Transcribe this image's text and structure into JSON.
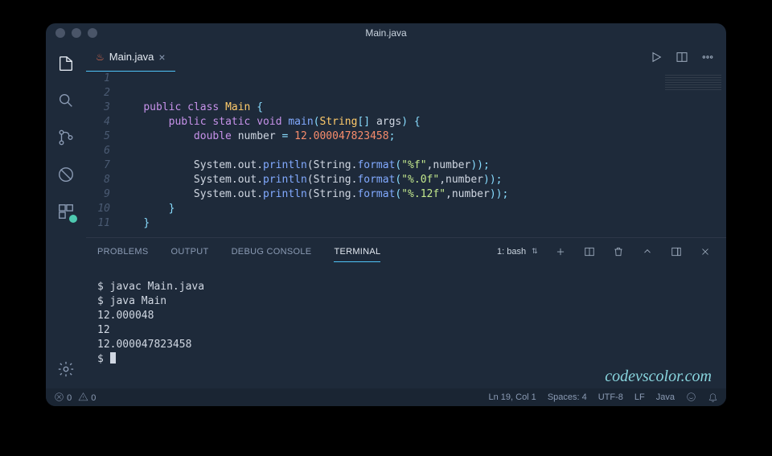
{
  "window_title": "Main.java",
  "tab": {
    "filename": "Main.java"
  },
  "editor": {
    "line_numbers": [
      "1",
      "2",
      "3",
      "4",
      "5",
      "6",
      "7",
      "8",
      "9",
      "10",
      "11"
    ]
  },
  "code": {
    "l2_public": "public",
    "l2_class": "class",
    "l2_Main": "Main",
    "l2_brace": " {",
    "l3_public": "public",
    "l3_static": "static",
    "l3_void": "void",
    "l3_main": "main",
    "l3_paren1": "(",
    "l3_String": "String",
    "l3_brackets": "[] ",
    "l3_args": "args",
    "l3_paren2": ") {",
    "l4_double": "double",
    "l4_number": "number",
    "l4_eq": " = ",
    "l4_val": "12.000047823458",
    "l4_semi": ";",
    "sop_pre": "System.out.",
    "println": "println",
    "fmt_pre": "(String.",
    "format": "format",
    "open": "(",
    "f1": "\"%f\"",
    "f2": "\"%.0f\"",
    "f3": "\"%.12f\"",
    "comma_num": ",number",
    "close": "));",
    "l9": "}",
    "l10": "}"
  },
  "panel": {
    "tabs": {
      "problems": "PROBLEMS",
      "output": "OUTPUT",
      "debug": "DEBUG CONSOLE",
      "terminal": "TERMINAL"
    },
    "shell": "1: bash",
    "lines": [
      "$ javac Main.java",
      "$ java Main",
      "12.000048",
      "12",
      "12.000047823458",
      "$ "
    ]
  },
  "watermark": "codevscolor.com",
  "status": {
    "errors": "0",
    "warnings": "0",
    "ln": "Ln 19, Col 1",
    "spaces": "Spaces: 4",
    "enc": "UTF-8",
    "eol": "LF",
    "lang": "Java"
  }
}
